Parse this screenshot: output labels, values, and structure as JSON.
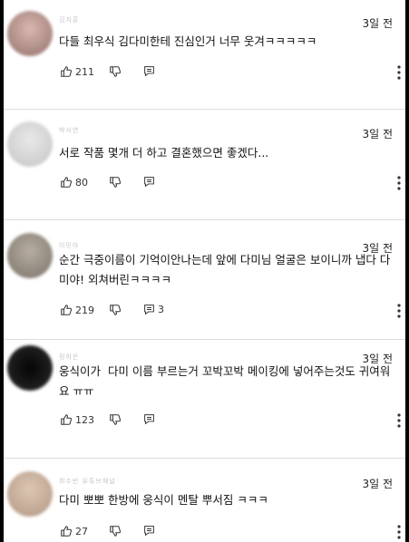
{
  "comments": [
    {
      "username": "김지훈",
      "time": "3일 전",
      "text": "다들 최우식 김다미한테 진심인거 너무 웃겨ㅋㅋㅋㅋㅋ",
      "likes": "211",
      "replies": ""
    },
    {
      "username": "박서연",
      "time": "3일 전",
      "text": "서로 작품 몇개 더 하고 결혼했으면 좋겠다...",
      "likes": "80",
      "replies": ""
    },
    {
      "username": "이민아",
      "time": "3일 전",
      "text": "순간 극중이름이 기억이안나는데 앞에 다미님 얼굴은 보이니까 냅다 다미야! 외쳐버린ㅋㅋㅋㅋ",
      "likes": "219",
      "replies": "3"
    },
    {
      "username": "정하은",
      "time": "3일 전",
      "text": "웅식이가  다미 이름 부르는거 꼬박꼬박 메이킹에 넣어주는것도 귀여워요 ㅠㅠ",
      "likes": "123",
      "replies": ""
    },
    {
      "username": "최수빈 유튜브채널",
      "time": "3일 전",
      "text": "다미 뽀뽀 한방에 웅식이 멘탈 뿌서짐 ㅋㅋㅋ",
      "likes": "27",
      "replies": ""
    }
  ],
  "icons": {
    "like": "thumbs-up-icon",
    "dislike": "thumbs-down-icon",
    "reply": "reply-icon",
    "more": "more-vertical-icon",
    "creator_heart": "creator-heart-icon"
  },
  "colors": {
    "heart": "#e0202a",
    "divider": "#dcdcdc"
  }
}
